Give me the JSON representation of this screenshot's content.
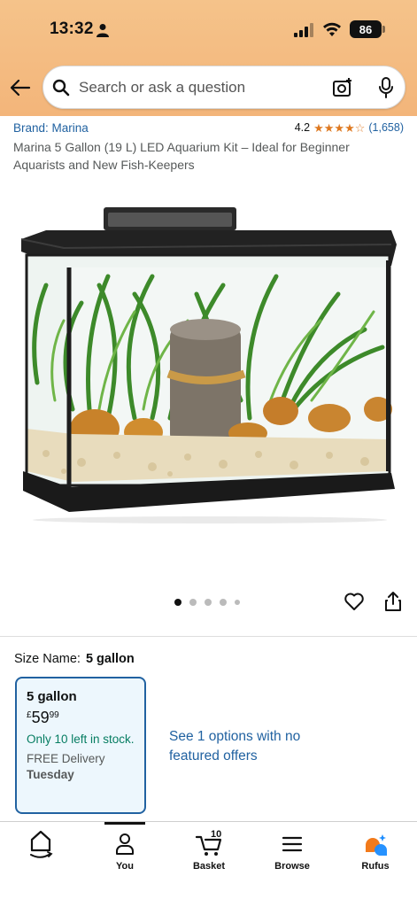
{
  "status_bar": {
    "time": "13:32",
    "battery": "86"
  },
  "search": {
    "placeholder": "Search or ask a question"
  },
  "product": {
    "brand": "Brand: Marina",
    "rating": "4.2",
    "rating_count": "(1,658)",
    "title": "Marina 5 Gallon (19 L) LED Aquarium Kit – Ideal for Beginner Aquarists and New Fish-Keepers",
    "image_count": 5,
    "active_image": 1
  },
  "size": {
    "label": "Size Name:",
    "selected": "5 gallon",
    "option": {
      "title": "5 gallon",
      "currency": "£",
      "price_whole": "59",
      "price_fraction": "99",
      "stock": "Only 10 left in stock.",
      "delivery": "FREE Delivery",
      "delivery_day": "Tuesday"
    },
    "offers_link": "See 1 options with no featured offers"
  },
  "nav": {
    "items": [
      {
        "label": "",
        "icon": "home-icon"
      },
      {
        "label": "You",
        "icon": "person-icon"
      },
      {
        "label": "Basket",
        "icon": "cart-icon",
        "count": "10"
      },
      {
        "label": "Browse",
        "icon": "menu-icon"
      },
      {
        "label": "Rufus",
        "icon": "rufus-icon"
      }
    ]
  },
  "colors": {
    "header": "#f3b57a",
    "link": "#2162a1",
    "stock": "#067d62",
    "star": "#de7921",
    "card_bg": "#edf7fd"
  }
}
